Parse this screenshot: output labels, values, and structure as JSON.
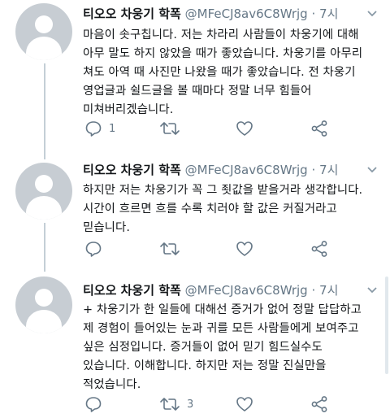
{
  "tweets": [
    {
      "author": "티오오 차웅기 학폭",
      "handle": "@MFeCJ8av6C8Wrjg",
      "separator": "·",
      "time": "7시",
      "text": "마음이 솟구칩니다. 저는 차라리 사람들이 차웅기에 대해\n아무 말도 하지 않았을 때가 좋았습니다. 차웅기를 아무리\n쳐도 아역 때 사진만 나왔을 때가 좋았습니다. 전 차웅기\n영업글과 쉴드글을 볼 때마다 정말 너무 힘들어\n미쳐버리겠습니다.",
      "actions": {
        "reply_count": "1",
        "retweet_count": "",
        "like_count": ""
      }
    },
    {
      "author": "티오오 차웅기 학폭",
      "handle": "@MFeCJ8av6C8Wrjg",
      "separator": "·",
      "time": "7시",
      "text": "하지만 저는 차웅기가 꼭 그 죗값을 받을거라 생각합니다.\n시간이 흐르면 흐를 수록 치러야 할 값은 커질거라고\n믿습니다.",
      "actions": {
        "reply_count": "",
        "retweet_count": "",
        "like_count": ""
      }
    },
    {
      "author": "티오오 차웅기 학폭",
      "handle": "@MFeCJ8av6C8Wrjg",
      "separator": "·",
      "time": "7시",
      "text": "+ 차웅기가 한 일들에 대해선 증거가 없어 정말 답답하고\n제 경험이 들어있는 눈과 귀를 모든 사람들에게 보여주고\n싶은 심정입니다. 증거들이 없어 믿기 힘드실수도\n있습니다. 이해합니다. 하지만 저는 정말 진실만을\n적었습니다.",
      "actions": {
        "reply_count": "",
        "retweet_count": "3",
        "like_count": ""
      }
    }
  ],
  "icons": {
    "more": "chevron-down-icon",
    "reply": "reply-icon",
    "retweet": "retweet-icon",
    "like": "heart-icon",
    "share": "share-icon"
  },
  "colors": {
    "text": "#14171a",
    "muted": "#657786",
    "thread_line": "#c4cfd6",
    "avatar_bg": "#c7cdd3"
  }
}
